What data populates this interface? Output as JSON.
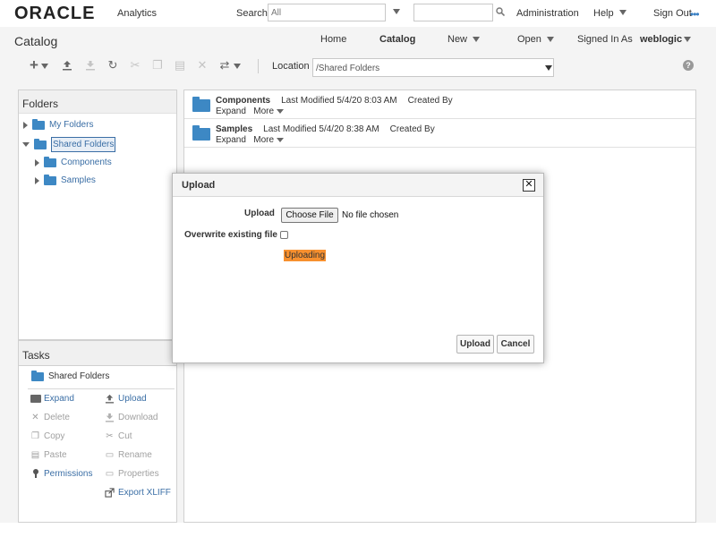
{
  "header": {
    "brand": "ORACLE",
    "product": "Analytics",
    "search_label": "Search",
    "search_scope": "All",
    "links": {
      "administration": "Administration",
      "help": "Help",
      "sign_out": "Sign Out"
    },
    "more_icon": "•••"
  },
  "subheader": {
    "title": "Catalog",
    "nav": {
      "home": "Home",
      "catalog": "Catalog",
      "new": "New",
      "open": "Open",
      "signed_in_as": "Signed In As",
      "user": "weblogic"
    }
  },
  "toolbar": {
    "location_label": "Location",
    "location_value": "/Shared Folders",
    "help_icon": "?"
  },
  "folders": {
    "title": "Folders",
    "items": [
      {
        "label": "My Folders"
      },
      {
        "label": "Shared Folders"
      },
      {
        "label": "Components"
      },
      {
        "label": "Samples"
      }
    ]
  },
  "tasks": {
    "title": "Tasks",
    "context": "Shared Folders",
    "items": [
      {
        "label": "Expand",
        "icon": "expand-icon",
        "enabled": true
      },
      {
        "label": "Upload",
        "icon": "upload-icon",
        "enabled": true
      },
      {
        "label": "Delete",
        "icon": "delete-icon",
        "enabled": false
      },
      {
        "label": "Download",
        "icon": "download-icon",
        "enabled": false
      },
      {
        "label": "Copy",
        "icon": "copy-icon",
        "enabled": false
      },
      {
        "label": "Cut",
        "icon": "cut-icon",
        "enabled": false
      },
      {
        "label": "Paste",
        "icon": "paste-icon",
        "enabled": false
      },
      {
        "label": "Rename",
        "icon": "rename-icon",
        "enabled": false
      },
      {
        "label": "Permissions",
        "icon": "permissions-icon",
        "enabled": true
      },
      {
        "label": "Properties",
        "icon": "properties-icon",
        "enabled": false
      },
      {
        "label": "Export XLIFF",
        "icon": "export-icon",
        "enabled": true
      }
    ]
  },
  "content": {
    "rows": [
      {
        "name": "Components",
        "modified": "Last Modified 5/4/20 8:03 AM",
        "created": "Created By",
        "expand": "Expand",
        "more": "More"
      },
      {
        "name": "Samples",
        "modified": "Last Modified 5/4/20 8:38 AM",
        "created": "Created By",
        "expand": "Expand",
        "more": "More"
      }
    ]
  },
  "dialog": {
    "title": "Upload",
    "close": "✕",
    "upload_label": "Upload",
    "choose_file": "Choose File",
    "no_file": "No file chosen",
    "overwrite_label": "Overwrite existing file",
    "status": "Uploading",
    "upload_button": "Upload",
    "cancel_button": "Cancel"
  },
  "colors": {
    "accent": "#3a6ea5",
    "folder": "#3d88c4",
    "status_highlight": "#f7902f"
  }
}
